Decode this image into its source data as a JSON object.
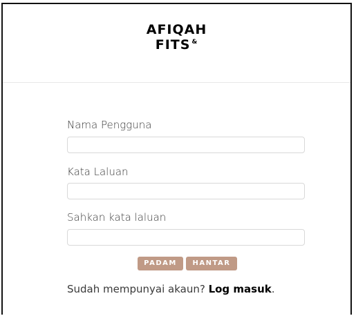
{
  "brand": {
    "line1": "AFIQAH",
    "line2": "FITS",
    "mark": "&"
  },
  "form": {
    "username_label": "Nama Pengguna",
    "username_value": "",
    "password_label": "Kata Laluan",
    "password_value": "",
    "confirm_label": "Sahkan kata laluan",
    "confirm_value": "",
    "reset_button": "PADAM",
    "submit_button": "HANTAR"
  },
  "footer": {
    "prompt": "Sudah mempunyai akaun? ",
    "link": "Log masuk",
    "period": "."
  },
  "colors": {
    "button": "#c09a86",
    "text": "#3a3a3a"
  }
}
